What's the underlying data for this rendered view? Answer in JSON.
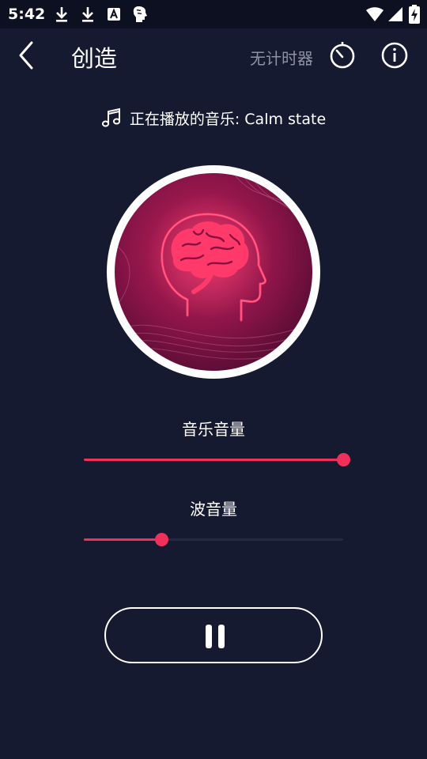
{
  "status_bar": {
    "time": "5:42",
    "icons": [
      "download-icon",
      "download-icon",
      "font-a-icon",
      "brain-icon",
      "wifi-icon",
      "signal-icon",
      "battery-charging-icon"
    ]
  },
  "app_bar": {
    "title": "创造",
    "timer_label": "无计时器",
    "icons": [
      "back-arrow-icon",
      "timer-icon",
      "info-icon"
    ]
  },
  "now_playing": {
    "label": "正在播放的音乐: Calm state",
    "icon": "music-note-icon"
  },
  "music_volume": {
    "label": "音乐音量",
    "value": 1.0
  },
  "wave_volume": {
    "label": "波音量",
    "value": 0.3
  },
  "playback": {
    "icon": "pause-icon"
  },
  "colors": {
    "background": "#161a30",
    "accent": "#f0305a",
    "muted_text": "#8e92a6"
  }
}
